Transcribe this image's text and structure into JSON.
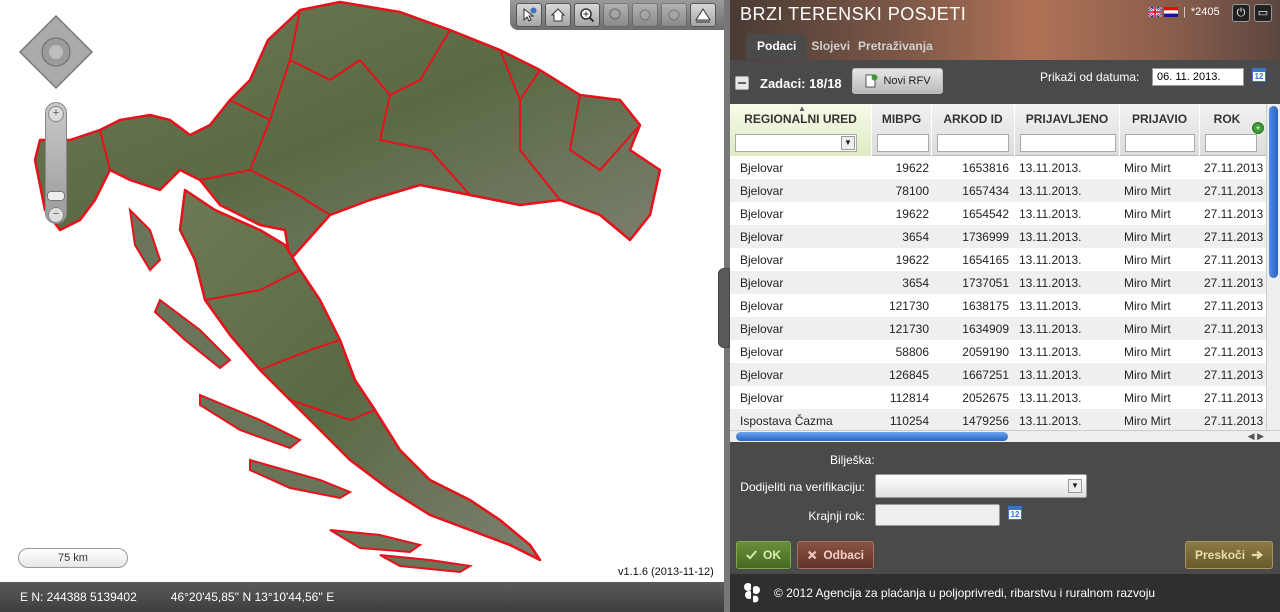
{
  "app": {
    "title": "BRZI TERENSKI POSJETI",
    "user": "*2405"
  },
  "tabs": [
    {
      "label": "Podaci",
      "active": true
    },
    {
      "label": "Slojevi"
    },
    {
      "label": "Pretraživanja"
    }
  ],
  "toolbar": {
    "tasks_label": "Zadaci: 18/18",
    "new_button": "Novi RFV",
    "date_label": "Prikaži od datuma:",
    "date_value": "06. 11. 2013."
  },
  "table": {
    "columns": [
      "REGIONALNI URED",
      "MIBPG",
      "ARKOD ID",
      "PRIJAVLJENO",
      "PRIJAVIO",
      "ROK"
    ],
    "rows": [
      [
        "Bjelovar",
        "19622",
        "1653816",
        "13.11.2013.",
        "Miro Mirt",
        "27.11.2013"
      ],
      [
        "Bjelovar",
        "78100",
        "1657434",
        "13.11.2013.",
        "Miro Mirt",
        "27.11.2013"
      ],
      [
        "Bjelovar",
        "19622",
        "1654542",
        "13.11.2013.",
        "Miro Mirt",
        "27.11.2013"
      ],
      [
        "Bjelovar",
        "3654",
        "1736999",
        "13.11.2013.",
        "Miro Mirt",
        "27.11.2013"
      ],
      [
        "Bjelovar",
        "19622",
        "1654165",
        "13.11.2013.",
        "Miro Mirt",
        "27.11.2013"
      ],
      [
        "Bjelovar",
        "3654",
        "1737051",
        "13.11.2013.",
        "Miro Mirt",
        "27.11.2013"
      ],
      [
        "Bjelovar",
        "121730",
        "1638175",
        "13.11.2013.",
        "Miro Mirt",
        "27.11.2013"
      ],
      [
        "Bjelovar",
        "121730",
        "1634909",
        "13.11.2013.",
        "Miro Mirt",
        "27.11.2013"
      ],
      [
        "Bjelovar",
        "58806",
        "2059190",
        "13.11.2013.",
        "Miro Mirt",
        "27.11.2013"
      ],
      [
        "Bjelovar",
        "126845",
        "1667251",
        "13.11.2013.",
        "Miro Mirt",
        "27.11.2013"
      ],
      [
        "Bjelovar",
        "112814",
        "2052675",
        "13.11.2013.",
        "Miro Mirt",
        "27.11.2013"
      ],
      [
        "Ispostava Čazma",
        "110254",
        "1479256",
        "13.11.2013.",
        "Miro Mirt",
        "27.11.2013"
      ]
    ]
  },
  "form": {
    "note_label": "Bilješka:",
    "assign_label": "Dodijeliti na verifikaciju:",
    "deadline_label": "Krajnji rok:"
  },
  "buttons": {
    "ok": "OK",
    "cancel": "Odbaci",
    "skip": "Preskoči"
  },
  "footer": "© 2012 Agencija za plaćanja u poljoprivredi, ribarstvu i ruralnom razvoju",
  "map": {
    "scale": "75 km",
    "version": "v1.1.6 (2013-11-12)",
    "coords_en": "E N: 244388 5139402",
    "coords_latlon": "46°20'45,85'' N 13°10'44,56'' E"
  },
  "colors": {
    "accent": "#3b73c6",
    "border_red": "#e8101a",
    "panel_bg": "#4a4a4a"
  },
  "icons": [
    "pointer-info-icon",
    "home-icon",
    "zoom-in-icon",
    "zoom-out-icon",
    "pan-icon",
    "history-icon",
    "measure-icon",
    "calendar-icon",
    "power-icon",
    "maximize-icon",
    "add-column-icon",
    "checkmark-icon",
    "x-icon",
    "arrow-right-icon",
    "agency-logo-icon"
  ]
}
